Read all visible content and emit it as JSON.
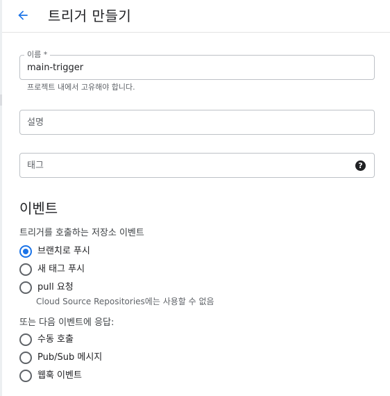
{
  "header": {
    "title": "트리거 만들기",
    "back_icon": "arrow-back-icon",
    "accent_color": "#1a73e8"
  },
  "form": {
    "name": {
      "label": "이름 *",
      "value": "main-trigger",
      "help": "프로젝트 내에서 고유해야 합니다."
    },
    "description": {
      "placeholder": "설명",
      "value": ""
    },
    "tags": {
      "placeholder": "태그",
      "value": "",
      "help_icon": "help-circle-icon",
      "help_glyph": "?"
    }
  },
  "event": {
    "title": "이벤트",
    "repo_label": "트리거를 호출하는 저장소 이벤트",
    "repo_options": [
      {
        "label": "브랜치로 푸시",
        "selected": true
      },
      {
        "label": "새 태그 푸시",
        "selected": false
      },
      {
        "label": "pull 요청",
        "selected": false,
        "note": "Cloud Source Repositories에는 사용할 수 없음"
      }
    ],
    "other_label": "또는 다음 이벤트에 응답:",
    "other_options": [
      {
        "label": "수동 호출",
        "selected": false
      },
      {
        "label": "Pub/Sub 메시지",
        "selected": false
      },
      {
        "label": "웹훅 이벤트",
        "selected": false
      }
    ]
  }
}
